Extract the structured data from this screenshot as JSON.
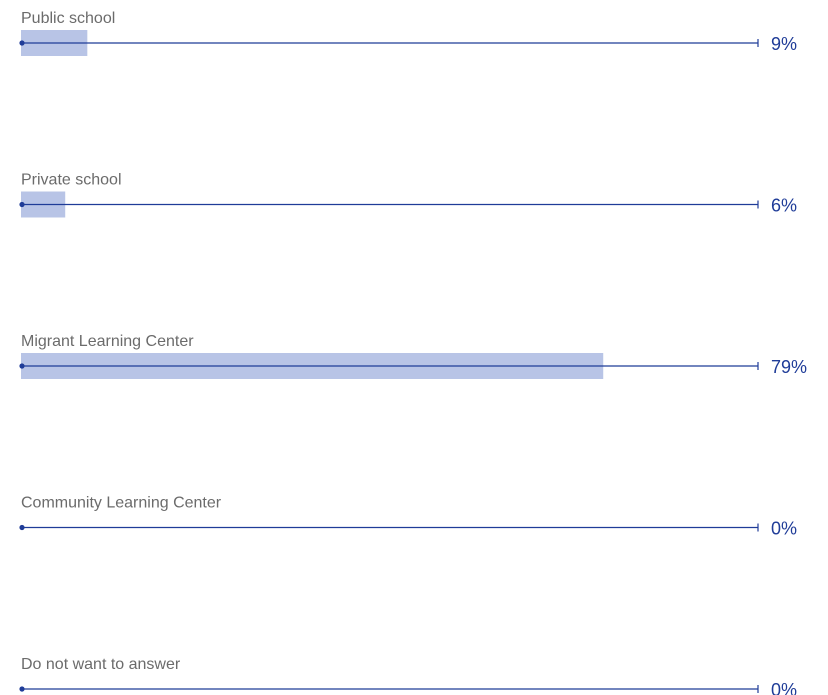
{
  "chart_data": {
    "type": "bar",
    "orientation": "horizontal",
    "categories": [
      "Public school",
      "Private school",
      "Migrant Learning Center",
      "Community Learning Center",
      "Do not want to answer"
    ],
    "values": [
      9,
      6,
      79,
      0,
      0
    ],
    "value_labels": [
      "9%",
      "6%",
      "79%",
      "0%",
      "0%"
    ],
    "xlim": [
      0,
      100
    ],
    "bar_color": "#b8c4e6",
    "line_color": "#1f3c98",
    "label_color": "#6b6b6b",
    "value_color": "#1f3c98"
  }
}
